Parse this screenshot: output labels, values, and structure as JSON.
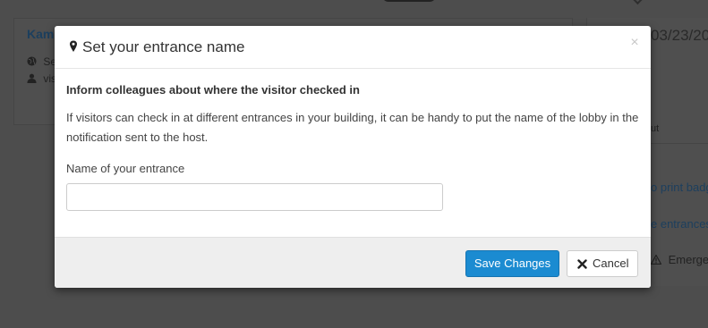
{
  "background": {
    "card_title": "Kam",
    "card_line_1": "Se",
    "card_line_2": "vis",
    "right_date": "03/23/20",
    "right_item_1": "ut",
    "right_item_2": "o print badg",
    "right_item_3": "e entrances",
    "right_item_4": "Emerger"
  },
  "modal": {
    "title": "Set your entrance name",
    "title_icon": "map-marker-icon",
    "close_label": "×",
    "heading": "Inform colleagues about where the visitor checked in",
    "description": "If visitors can check in at different entrances in your building, it can be handy to put the name of the lobby in the notification sent to the host.",
    "field_label": "Name of your entrance",
    "field_value": "",
    "field_placeholder": "",
    "save_label": "Save Changes",
    "cancel_label": "Cancel",
    "cancel_icon": "close-icon"
  },
  "colors": {
    "overlay": "#4d4d4d",
    "primary_button": "#1b8bd1",
    "footer": "#eeeeee"
  }
}
